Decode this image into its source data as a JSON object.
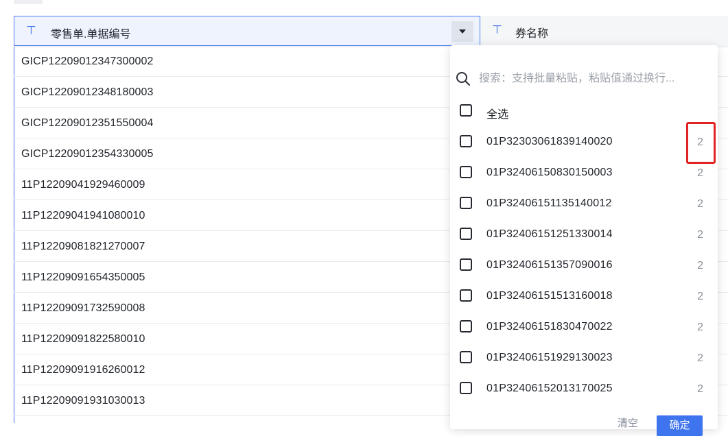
{
  "table": {
    "columns": [
      {
        "title": "零售单.单据编号",
        "type_icon": "text-type-icon"
      },
      {
        "title": "券名称",
        "type_icon": "text-type-icon"
      }
    ],
    "rows": [
      "GICP12209012347300002",
      "GICP12209012348180003",
      "GICP12209012351550004",
      "GICP12209012354330005",
      "11P12209041929460009",
      "11P12209041941080010",
      "11P12209081821270007",
      "11P12209091654350005",
      "11P12209091732590008",
      "11P12209091822580010",
      "11P12209091916260012",
      "11P12209091931030013"
    ]
  },
  "filter_dropdown": {
    "search_placeholder": "搜索：支持批量粘贴，粘贴值通过换行...",
    "select_all_label": "全选",
    "options": [
      {
        "label": "01P32303061839140020",
        "count": "2"
      },
      {
        "label": "01P32406150830150003",
        "count": "2"
      },
      {
        "label": "01P32406151135140012",
        "count": "2"
      },
      {
        "label": "01P32406151251330014",
        "count": "2"
      },
      {
        "label": "01P32406151357090016",
        "count": "2"
      },
      {
        "label": "01P32406151513160018",
        "count": "2"
      },
      {
        "label": "01P32406151830470022",
        "count": "2"
      },
      {
        "label": "01P32406151929130023",
        "count": "2"
      },
      {
        "label": "01P32406152013170025",
        "count": "2"
      }
    ],
    "footer_link": "清空",
    "confirm_label": "确定"
  },
  "colors": {
    "accent": "#3e74ee",
    "highlight": "#e02323"
  }
}
